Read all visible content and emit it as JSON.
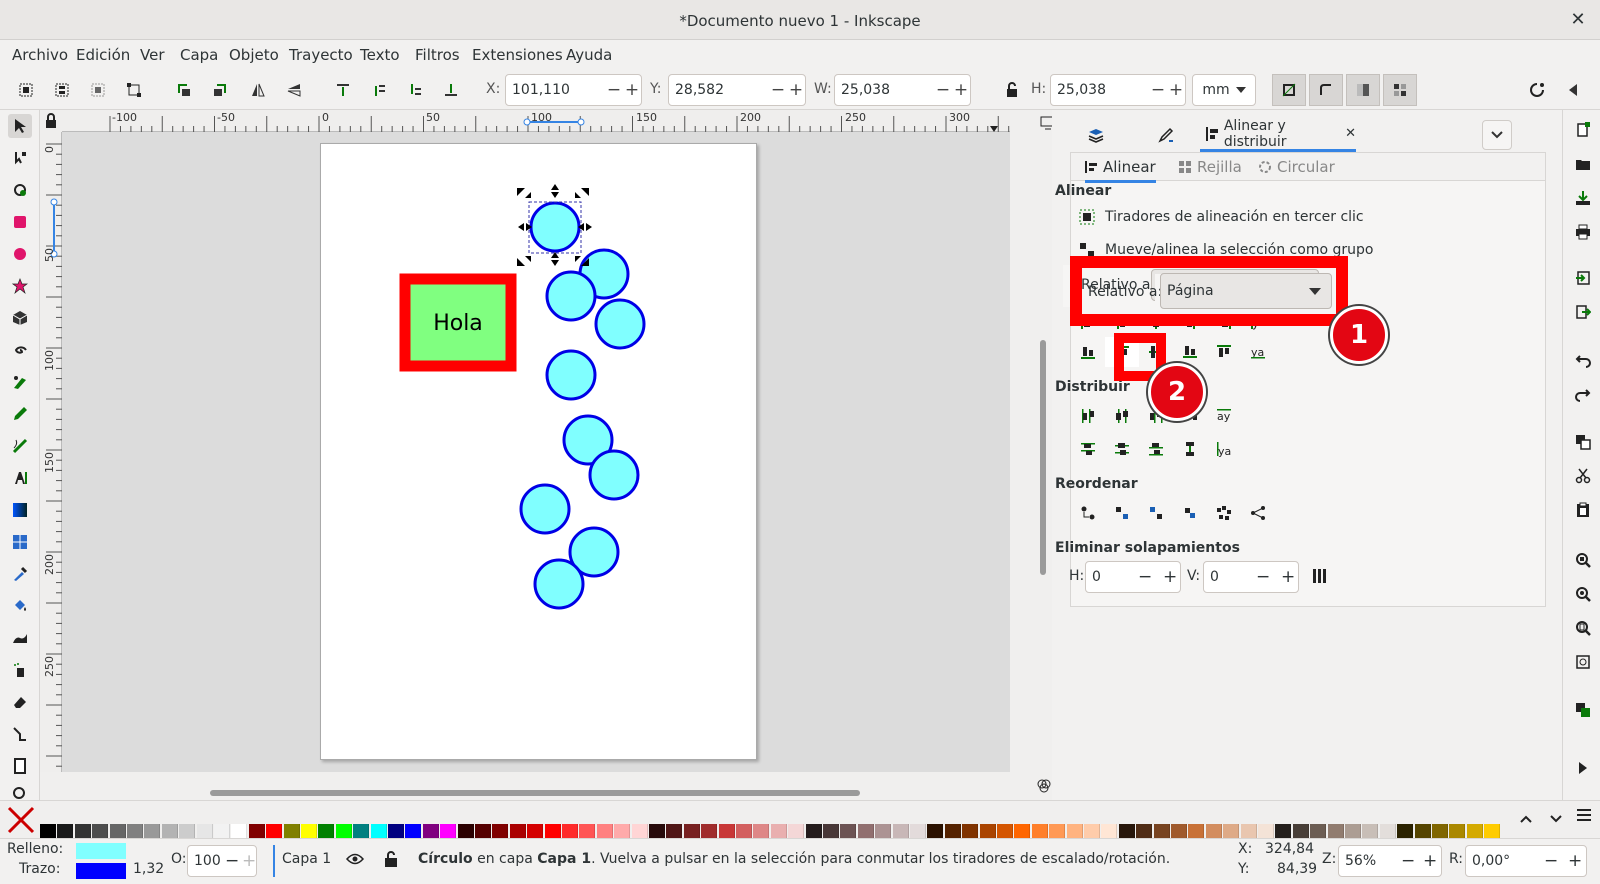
{
  "window": {
    "title": "*Documento nuevo 1 - Inkscape",
    "close": "✕"
  },
  "menu": [
    "Archivo",
    "Edición",
    "Ver",
    "Capa",
    "Objeto",
    "Trayecto",
    "Texto",
    "Filtros",
    "Extensiones",
    "Ayuda"
  ],
  "toolbar": {
    "x_label": "X:",
    "x_value": "101,110",
    "y_label": "Y:",
    "y_value": "28,582",
    "w_label": "W:",
    "w_value": "25,038",
    "h_label": "H:",
    "h_value": "25,038",
    "unit": "mm",
    "minus": "−",
    "plus": "+"
  },
  "ruler_top": [
    "-100",
    "-50",
    "0",
    "50",
    "100",
    "150",
    "200",
    "250",
    "300"
  ],
  "ruler_left": [
    "0",
    "50",
    "100",
    "150",
    "200",
    "250"
  ],
  "canvas": {
    "text": "Hola"
  },
  "dock": {
    "tab_active": "Alinear y distribuir",
    "tab_close": "✕",
    "subtabs": [
      "Alinear",
      "Rejilla",
      "Circular"
    ],
    "section_align": "Alinear",
    "opt1": "Tiradores de alineación en tercer clic",
    "opt2": "Mueve/alinea la selección como grupo",
    "relative_label": "Relativo a:",
    "relative_value": "Página",
    "section_distribute": "Distribuir",
    "section_reorder": "Reordenar",
    "section_overlap": "Eliminar solapamientos",
    "h_label": "H:",
    "h_value": "0",
    "v_label": "V:",
    "v_value": "0"
  },
  "callouts": [
    "1",
    "2"
  ],
  "status": {
    "fill_label": "Relleno:",
    "stroke_label": "Trazo:",
    "stroke_width": "1,32",
    "opacity_label": "O:",
    "opacity_value": "100",
    "layer": "Capa 1",
    "msg_obj": "Círculo",
    "msg_mid": " en capa ",
    "msg_layer": "Capa 1",
    "msg_rest": ". Vuelva a pulsar en la selección para conmutar los tiradores de escalado/rotación.",
    "x_label": "X:",
    "x_value": "324,84",
    "y_label": "Y:",
    "y_value": "84,39",
    "zoom_label": "Z:",
    "zoom_value": "56%",
    "rot_label": "R:",
    "rot_value": "0,00°"
  },
  "colors": {
    "fill": "#80ffff",
    "stroke": "#0000ff",
    "highlight": "#ff0000",
    "rect_fill": "#80ff80"
  }
}
